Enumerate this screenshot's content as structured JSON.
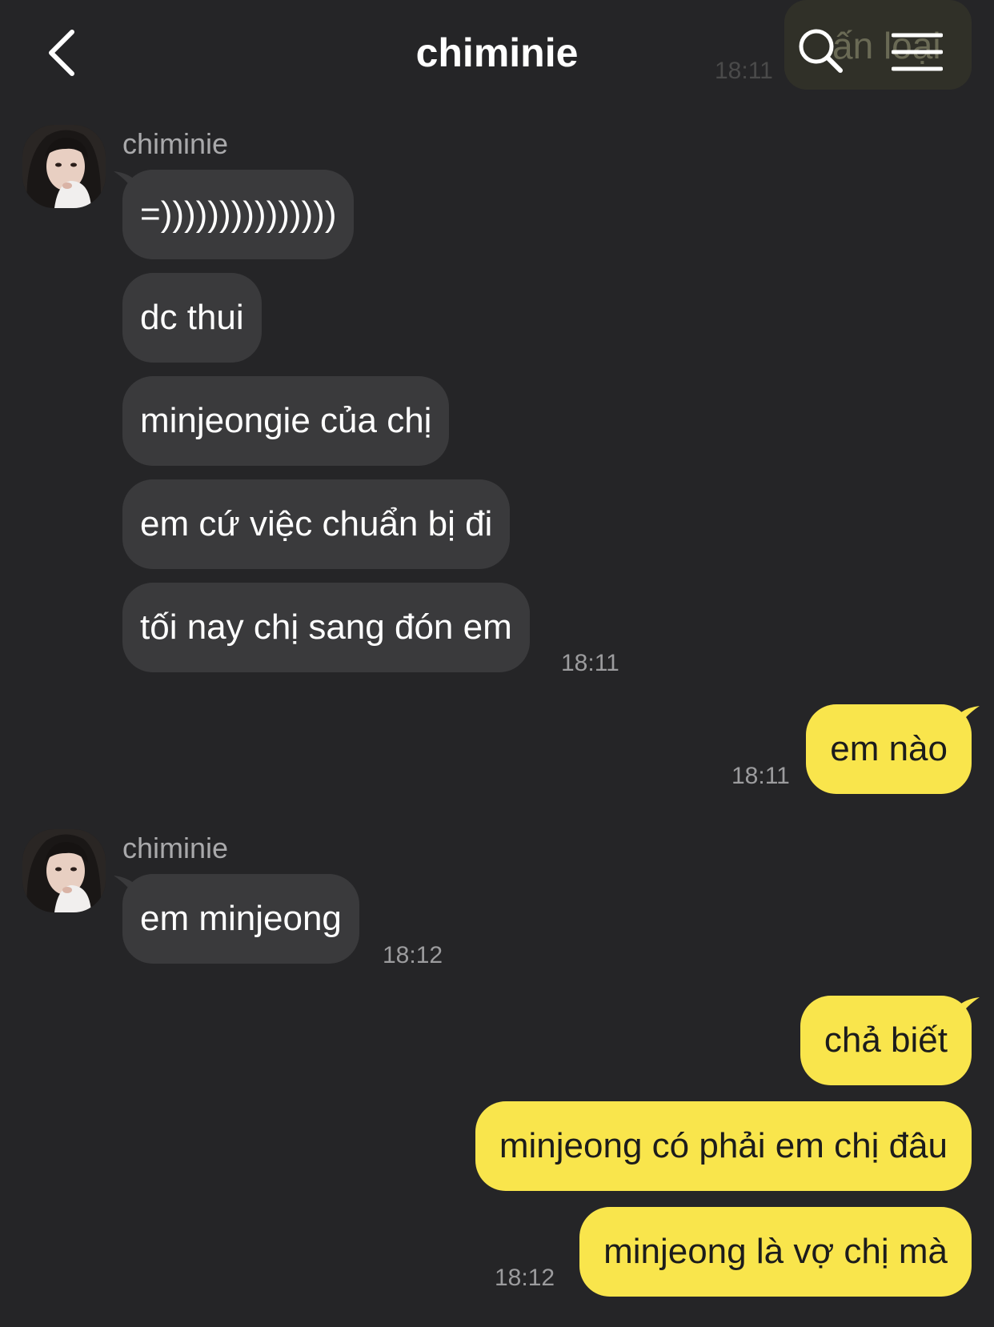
{
  "header": {
    "title": "chiminie",
    "ghost_text": "ấn loại",
    "ghost_time": "18:11"
  },
  "messages": {
    "group1": {
      "sender": "chiminie",
      "bubbles": [
        "=)))))))))))))))",
        "dc thui",
        "minjeongie của chị",
        "em cứ việc chuẩn bị đi",
        "tối nay chị sang đón em"
      ],
      "time": "18:11"
    },
    "out1": {
      "bubbles": [
        "em nào"
      ],
      "time": "18:11"
    },
    "group2": {
      "sender": "chiminie",
      "bubbles": [
        "em minjeong"
      ],
      "time": "18:12"
    },
    "out2": {
      "bubbles": [
        "chả biết",
        "minjeong có phải em chị đâu",
        "minjeong là vợ chị mà"
      ],
      "time": "18:12"
    }
  },
  "colors": {
    "background": "#252527",
    "incoming_bubble": "#3a3a3c",
    "outgoing_bubble": "#f9e54c"
  },
  "icons": {
    "back": "chevron-left-icon",
    "search": "search-icon",
    "menu": "hamburger-menu-icon"
  }
}
